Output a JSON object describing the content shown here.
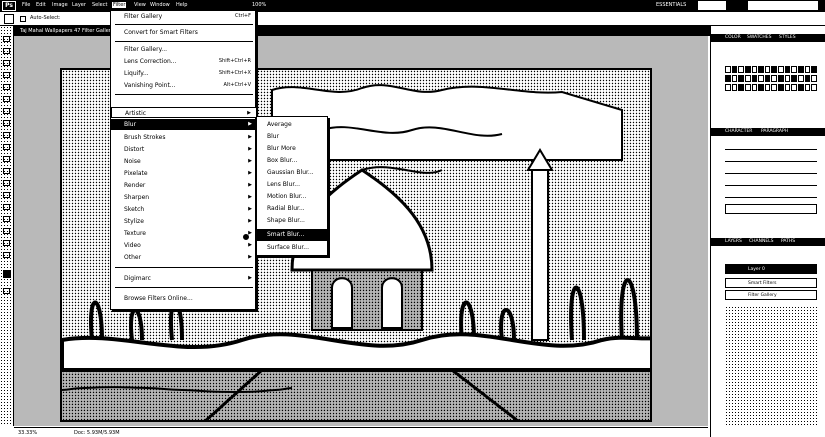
{
  "menubar": {
    "app_logo": "Ps",
    "menus": [
      "File",
      "Edit",
      "Image",
      "Layer",
      "Select",
      "Filter",
      "View",
      "Window",
      "Help"
    ],
    "zoom": "100%",
    "workspace_labels": [
      "ESSENTIALS"
    ],
    "essentials_label": "ESSENTIALS"
  },
  "options": {
    "auto_select_label": "Auto-Select:"
  },
  "document": {
    "tab_title": "Taj Mahal Wallpapers 47 Filter Gallery"
  },
  "filter_menu": {
    "items": [
      {
        "label": "Filter Gallery",
        "shortcut": "Ctrl+F"
      },
      {
        "label": "Convert for Smart Filters",
        "shortcut": ""
      },
      {
        "label": "Filter Gallery...",
        "shortcut": ""
      },
      {
        "label": "Lens Correction...",
        "shortcut": "Shift+Ctrl+R"
      },
      {
        "label": "Liquify...",
        "shortcut": "Shift+Ctrl+X"
      },
      {
        "label": "Vanishing Point...",
        "shortcut": "Alt+Ctrl+V"
      },
      {
        "label": "Artistic",
        "shortcut": ""
      },
      {
        "label": "Blur",
        "shortcut": ""
      },
      {
        "label": "Brush Strokes",
        "shortcut": ""
      },
      {
        "label": "Distort",
        "shortcut": ""
      },
      {
        "label": "Noise",
        "shortcut": ""
      },
      {
        "label": "Pixelate",
        "shortcut": ""
      },
      {
        "label": "Render",
        "shortcut": ""
      },
      {
        "label": "Sharpen",
        "shortcut": ""
      },
      {
        "label": "Sketch",
        "shortcut": ""
      },
      {
        "label": "Stylize",
        "shortcut": ""
      },
      {
        "label": "Texture",
        "shortcut": ""
      },
      {
        "label": "Video",
        "shortcut": ""
      },
      {
        "label": "Other",
        "shortcut": ""
      },
      {
        "label": "Digimarc",
        "shortcut": ""
      },
      {
        "label": "Browse Filters Online...",
        "shortcut": ""
      }
    ]
  },
  "blur_submenu": {
    "items": [
      "Average",
      "Blur",
      "Blur More",
      "Box Blur...",
      "Gaussian Blur...",
      "Lens Blur...",
      "Motion Blur...",
      "Radial Blur...",
      "Shape Blur...",
      "Smart Blur...",
      "Surface Blur..."
    ]
  },
  "panels": {
    "swatches_tabs": [
      "COLOR",
      "SWATCHES",
      "STYLES"
    ],
    "character_tabs": [
      "CHARACTER",
      "PARAGRAPH"
    ],
    "layers_tabs": [
      "LAYERS",
      "CHANNELS",
      "PATHS"
    ],
    "layer_rows": [
      "Layer 0",
      "Smart Filters",
      "Filter Gallery"
    ]
  },
  "status": {
    "zoom": "33.33%",
    "doc_size": "Doc: 5.93M/5.93M"
  },
  "colors": {
    "menu_bg": "#000000",
    "selected": "#000000",
    "background": "#ffffff"
  }
}
